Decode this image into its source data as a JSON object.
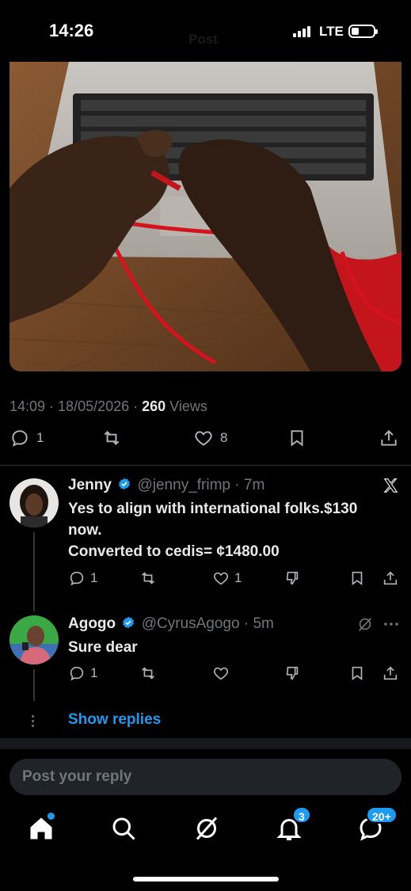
{
  "status": {
    "time": "14:26",
    "ghost_title": "Post",
    "network": "LTE"
  },
  "post": {
    "timestamp": "14:09 · 18/05/2026 · ",
    "views_count": "260",
    "views_label": " Views",
    "replies": "1",
    "likes": "8"
  },
  "replies": [
    {
      "name": "Jenny",
      "handle": "@jenny_frimp",
      "time": "· 7m",
      "text_line1": "Yes to align with international folks.$130",
      "text_line2": "now.",
      "text_line3": "Converted to cedis= ¢1480.00",
      "reply_count": "1",
      "like_count": "1"
    },
    {
      "name": "Agogo",
      "handle": "@CyrusAgogo",
      "time": "· 5m",
      "text_line1": "Sure dear",
      "reply_count": "1"
    }
  ],
  "show_replies": "Show replies",
  "composer": {
    "placeholder": "Post your reply"
  },
  "tabs": {
    "notifications_badge": "3",
    "messages_badge": "20+"
  },
  "colors": {
    "accent": "#1d9bf0",
    "muted": "#71767b",
    "background": "#000000"
  }
}
